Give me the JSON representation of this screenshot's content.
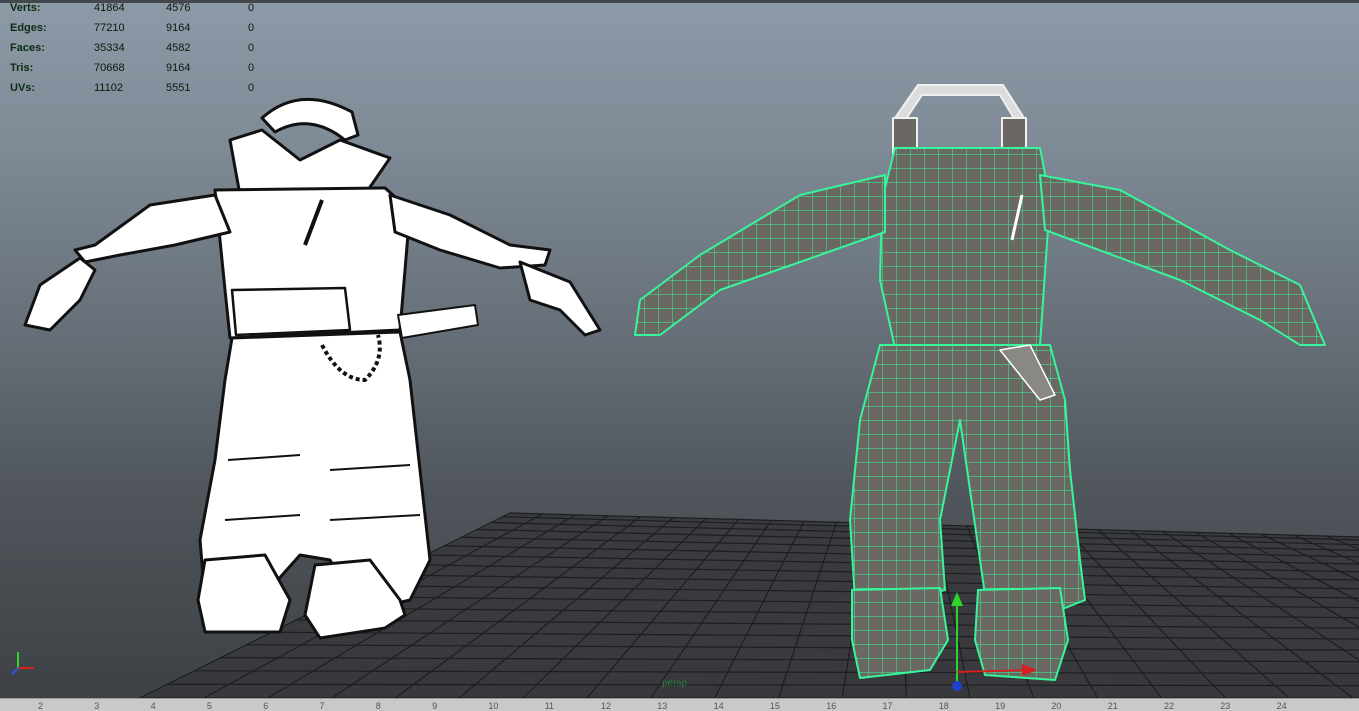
{
  "hud": {
    "rows": [
      {
        "label": "Verts:",
        "v1": "41864",
        "v2": "4576",
        "v3": "0"
      },
      {
        "label": "Edges:",
        "v1": "77210",
        "v2": "9164",
        "v3": "0"
      },
      {
        "label": "Faces:",
        "v1": "35334",
        "v2": "4582",
        "v3": "0"
      },
      {
        "label": "Tris:",
        "v1": "70668",
        "v2": "9164",
        "v3": "0"
      },
      {
        "label": "UVs:",
        "v1": "11102",
        "v2": "5551",
        "v3": "0"
      }
    ]
  },
  "camera_label": "persp",
  "ruler": {
    "ticks": [
      "2",
      "3",
      "4",
      "5",
      "6",
      "7",
      "8",
      "9",
      "10",
      "11",
      "12",
      "13",
      "14",
      "15",
      "16",
      "17",
      "18",
      "19",
      "20",
      "21",
      "22",
      "23",
      "24"
    ]
  },
  "colors": {
    "wire": "#3dff9a",
    "mesh_fill": "#6d6a66",
    "toon_fill": "#ffffff",
    "grid": "#1e1f21"
  },
  "icons": {
    "axis_gizmo": "xyz-axis-icon",
    "manipulator": "move-manipulator-icon"
  }
}
